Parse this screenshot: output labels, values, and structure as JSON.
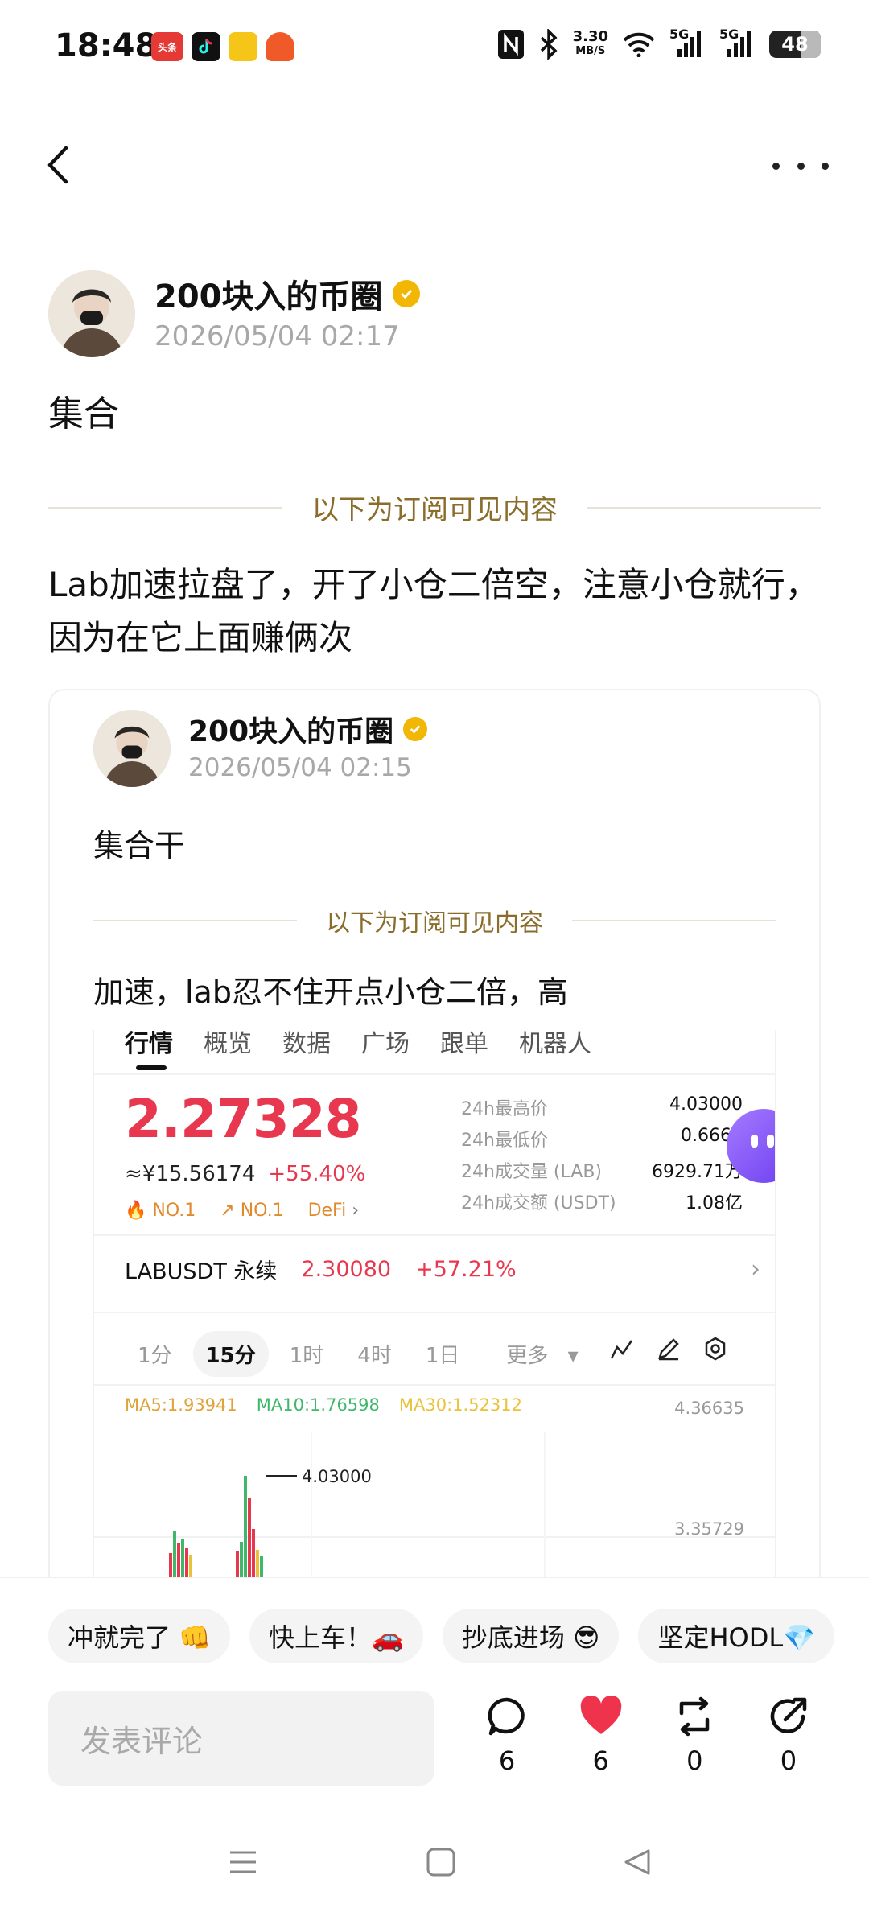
{
  "status_bar": {
    "time": "18:48",
    "notif_icons": [
      {
        "name": "toutiao-icon",
        "label": "头条",
        "color": "#e53935"
      },
      {
        "name": "douyin-icon",
        "label": "",
        "color": "#111111"
      },
      {
        "name": "photo-app-icon",
        "label": "",
        "color": "#f5c518"
      },
      {
        "name": "game-app-icon",
        "label": "",
        "color": "#f05a28"
      }
    ],
    "net_speed_value": "3.30",
    "net_speed_unit": "MB/S",
    "signal_1_label": "5G",
    "signal_2_label": "5G",
    "battery": "48"
  },
  "post": {
    "author": "200块入的币圈",
    "time": "2026/05/04 02:17",
    "title": "集合",
    "divider_label": "以下为订阅可见内容",
    "body": "Lab加速拉盘了，开了小仓二倍空，注意小仓就行，因为在它上面赚俩次"
  },
  "quoted_post": {
    "author": "200块入的币圈",
    "time": "2026/05/04 02:15",
    "title": "集合干",
    "divider_label": "以下为订阅可见内容",
    "body": "加速，lab忍不住开点小仓二倍，高",
    "screenshot": {
      "tabs": [
        "行情",
        "概览",
        "数据",
        "广场",
        "跟单",
        "机器人"
      ],
      "price": "2.27328",
      "cny": "≈¥15.56174",
      "change": "+55.40%",
      "tags": [
        "NO.1",
        "NO.1",
        "DeFi"
      ],
      "stats": [
        {
          "k": "24h最高价",
          "v": "4.03000"
        },
        {
          "k": "24h最低价",
          "v": "0.6664"
        },
        {
          "k": "24h成交量 (LAB)",
          "v": "6929.71万"
        },
        {
          "k": "24h成交额 (USDT)",
          "v": "1.08亿"
        }
      ],
      "perp_name": "LABUSDT 永续",
      "perp_price": "2.30080",
      "perp_change": "+57.21%",
      "intervals": [
        "1分",
        "15分",
        "1时",
        "4时",
        "1日",
        "更多"
      ],
      "active_interval": "15分",
      "ma": [
        {
          "label": "MA5:1.93941",
          "color": "#e0a33a"
        },
        {
          "label": "MA10:1.76598",
          "color": "#3fb86b"
        },
        {
          "label": "MA30:1.52312",
          "color": "#e8c33a"
        }
      ],
      "axis_top": "4.36635",
      "axis_mid": "3.35729",
      "peak_label": "4.03000"
    }
  },
  "bottom": {
    "quick_replies": [
      "冲就完了 👊",
      "快上车！🚗",
      "抄底进场 😎",
      "坚定HODL💎"
    ],
    "comment_placeholder": "发表评论",
    "comment_count": "6",
    "like_count": "6",
    "repost_count": "0",
    "share_count": "0"
  },
  "colors": {
    "accent_gold": "#8a6d2a",
    "price_red": "#e8384f",
    "verify_gold": "#f2b705"
  }
}
